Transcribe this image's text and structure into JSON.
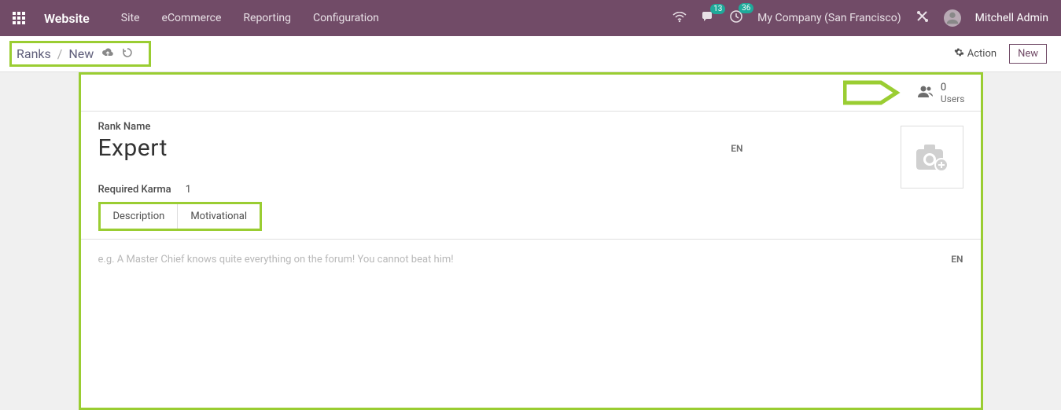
{
  "topbar": {
    "brand": "Website",
    "menu": [
      "Site",
      "eCommerce",
      "Reporting",
      "Configuration"
    ],
    "chat_badge": "13",
    "clock_badge": "36",
    "company": "My Company (San Francisco)",
    "user": "Mitchell Admin"
  },
  "controlbar": {
    "breadcrumb_root": "Ranks",
    "breadcrumb_current": "New",
    "action_label": "Action",
    "new_label": "New"
  },
  "stat": {
    "count": "0",
    "label": "Users"
  },
  "form": {
    "rank_name_label": "Rank Name",
    "rank_name_value": "Expert",
    "lang": "EN",
    "karma_label": "Required Karma",
    "karma_value": "1",
    "tabs": [
      "Description",
      "Motivational"
    ],
    "description_placeholder": "e.g. A Master Chief knows quite everything on the forum! You cannot beat him!"
  }
}
